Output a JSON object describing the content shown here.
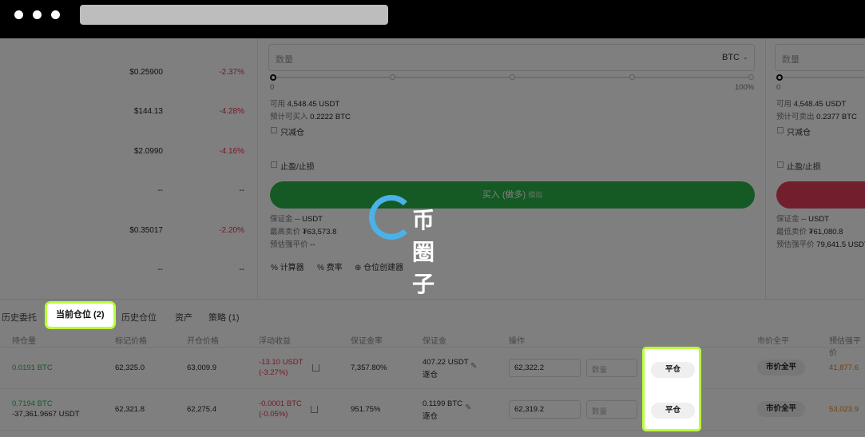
{
  "market_list": [
    {
      "price": "$0.25900",
      "change": "-2.37%"
    },
    {
      "price": "$144.13",
      "change": "-4.28%"
    },
    {
      "price": "$2.0990",
      "change": "-4.16%"
    },
    {
      "price": "--",
      "change": "--"
    },
    {
      "price": "$0.35017",
      "change": "-2.20%"
    },
    {
      "price": "--",
      "change": "--"
    }
  ],
  "buy_form": {
    "qty_placeholder": "数量",
    "unit": "BTC",
    "slider_min": "0",
    "slider_max": "100%",
    "slider_fraction": 0,
    "available_label": "可用",
    "available_value": "4,548.45 USDT",
    "est_label": "预计可买入",
    "est_value": "0.2222 BTC",
    "reduce_only": "只减仓",
    "tp_sl": "止盈/止损",
    "button_label": "买入 (做多)",
    "button_suffix": "模拟",
    "margin_label": "保证金",
    "margin_value": "-- USDT",
    "max_price_label": "最高卖价",
    "max_price_value": "₮63,573.8",
    "liq_label": "预估强平价",
    "liq_value": "--",
    "tools": [
      "计算器",
      "费率",
      "仓位创建器"
    ]
  },
  "sell_form": {
    "qty_placeholder": "数量",
    "available_label": "可用",
    "available_value": "4,548.45 USDT",
    "est_label": "预计可卖出",
    "est_value": "0.2377 BTC",
    "reduce_only": "只减仓",
    "tp_sl": "止盈/止损",
    "margin_label": "保证金",
    "margin_value": "-- USDT",
    "min_price_label": "最低卖价",
    "min_price_value": "₮61,080.8",
    "liq_label": "预估强平价",
    "liq_value": "79,641.5 USDT"
  },
  "watermark": "币圈子",
  "tabs": {
    "history_orders": "历史委托",
    "current_positions": "当前仓位 (2)",
    "history_positions": "历史仓位",
    "assets": "资产",
    "strategies": "策略 (1)"
  },
  "table": {
    "headers": {
      "position": "持仓量",
      "mark_price": "标记价格",
      "open_price": "开仓价格",
      "pnl": "浮动收益",
      "margin_rate": "保证金率",
      "margin": "保证金",
      "actions": "操作",
      "market_close": "市价全平",
      "liq_price": "预估强平价"
    },
    "rows": [
      {
        "position": "0.0191 BTC",
        "position_sub": "",
        "mark_price": "62,325.0",
        "open_price": "63,009.9",
        "pnl": "-13.10 USDT",
        "pnl_pct": "(-3.27%)",
        "margin_rate": "7,357.80%",
        "margin": "407.22 USDT",
        "margin_mode": "逐仓",
        "price_input": "62,322.2",
        "qty_placeholder": "数量",
        "close_label": "平仓",
        "market_close_label": "市价全平",
        "liq_price": "41,877.6"
      },
      {
        "position": "0.7194 BTC",
        "position_sub": "-37,361.9667 USDT",
        "mark_price": "62,321.8",
        "open_price": "62,275.4",
        "pnl": "-0.0001 BTC",
        "pnl_pct": "(-0.05%)",
        "margin_rate": "951.75%",
        "margin": "0.1199 BTC",
        "margin_mode": "逐仓",
        "price_input": "62,319.2",
        "qty_placeholder": "数量",
        "close_label": "平仓",
        "market_close_label": "市价全平",
        "liq_price": "53,023.9"
      }
    ]
  },
  "colors": {
    "buy": "#2bb34a",
    "sell": "#e23d5a",
    "highlight": "#b8ff3b"
  }
}
